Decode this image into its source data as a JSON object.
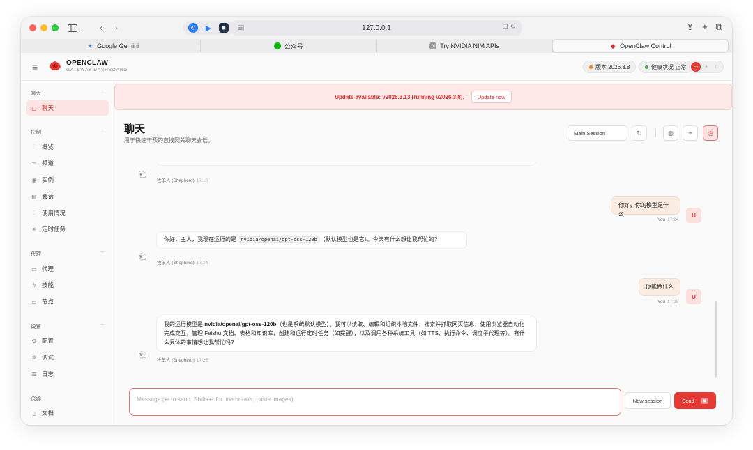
{
  "browser": {
    "url": "127.0.0.1",
    "tabs": [
      {
        "label": "Google Gemini",
        "icon": "gemini-icon",
        "color": "#4285f4"
      },
      {
        "label": "公众号",
        "icon": "wechat-icon",
        "color": "#09bb07"
      },
      {
        "label": "Try NVIDIA NIM APIs",
        "icon": "nvidia-n-icon",
        "color": "#888888"
      },
      {
        "label": "OpenClaw Control",
        "icon": "openclaw-icon",
        "color": "#d32f2f"
      }
    ]
  },
  "header": {
    "brand_title": "OPENCLAW",
    "brand_subtitle": "GATEWAY DASHBOARD",
    "version_label": "版本 2026.3.8",
    "health_label": "健康状况 正常",
    "accent": "#e53935"
  },
  "sidebar": {
    "sections": [
      {
        "label": "聊天",
        "items": [
          {
            "label": "聊天",
            "icon": "chat-icon",
            "active": true
          }
        ]
      },
      {
        "label": "控制",
        "items": [
          {
            "label": "概览",
            "icon": "bar-chart-icon"
          },
          {
            "label": "频道",
            "icon": "link-icon"
          },
          {
            "label": "实例",
            "icon": "broadcast-icon"
          },
          {
            "label": "会话",
            "icon": "document-icon"
          },
          {
            "label": "使用情况",
            "icon": "usage-chart-icon"
          },
          {
            "label": "定时任务",
            "icon": "loader-icon"
          }
        ]
      },
      {
        "label": "代理",
        "items": [
          {
            "label": "代理",
            "icon": "folder-icon"
          },
          {
            "label": "技能",
            "icon": "lightning-icon"
          },
          {
            "label": "节点",
            "icon": "monitor-icon"
          }
        ]
      },
      {
        "label": "设置",
        "items": [
          {
            "label": "配置",
            "icon": "gear-icon"
          },
          {
            "label": "调试",
            "icon": "bug-icon"
          },
          {
            "label": "日志",
            "icon": "log-icon"
          }
        ]
      },
      {
        "label": "资源",
        "items": [
          {
            "label": "文档",
            "icon": "book-icon"
          }
        ]
      }
    ]
  },
  "banner": {
    "text": "Update available: v2026.3.13 (running v2026.3.8).",
    "button": "Update now"
  },
  "page": {
    "title": "聊天",
    "subtitle": "用于快速干预的直接网关聊天会话。",
    "session_select": "Main Session"
  },
  "messages": [
    {
      "role": "assistant",
      "sender": "牧羊人 (Shepherd)",
      "time": "17:10",
      "text": ""
    },
    {
      "role": "user",
      "sender": "You",
      "time": "17:24",
      "text": "你好，你的模型是什么",
      "avatar": "U"
    },
    {
      "role": "assistant",
      "sender": "牧羊人 (Shepherd)",
      "time": "17:24",
      "text_before": "你好，主人，我现在运行的是 ",
      "code": "nvidia/openai/gpt-oss-120b",
      "text_after": "（默认模型也是它）。今天有什么想让我帮忙的?"
    },
    {
      "role": "user",
      "sender": "You",
      "time": "17:25",
      "text": "你能做什么",
      "avatar": "U"
    },
    {
      "role": "assistant",
      "sender": "牧羊人 (Shepherd)",
      "time": "17:25",
      "text_before": "我的运行模型是 ",
      "bold": "nvidia/openai/gpt-oss-120b",
      "text_after": "（也是系统默认模型）。我可以读取、编辑和组织本地文件，搜索并抓取网页信息，使用浏览器自动化完成交互，管理 Feishu 文档、表格和知识库，创建和运行定时任务（如提醒），以及调用各种系统工具（如 TTS、执行命令、调度子代理等）。有什么具体的事情想让我帮忙吗?"
    }
  ],
  "composer": {
    "placeholder": "Message (↩ to send, Shift+↩ for line breaks, paste images)",
    "new_session": "New session",
    "send": "Send"
  }
}
